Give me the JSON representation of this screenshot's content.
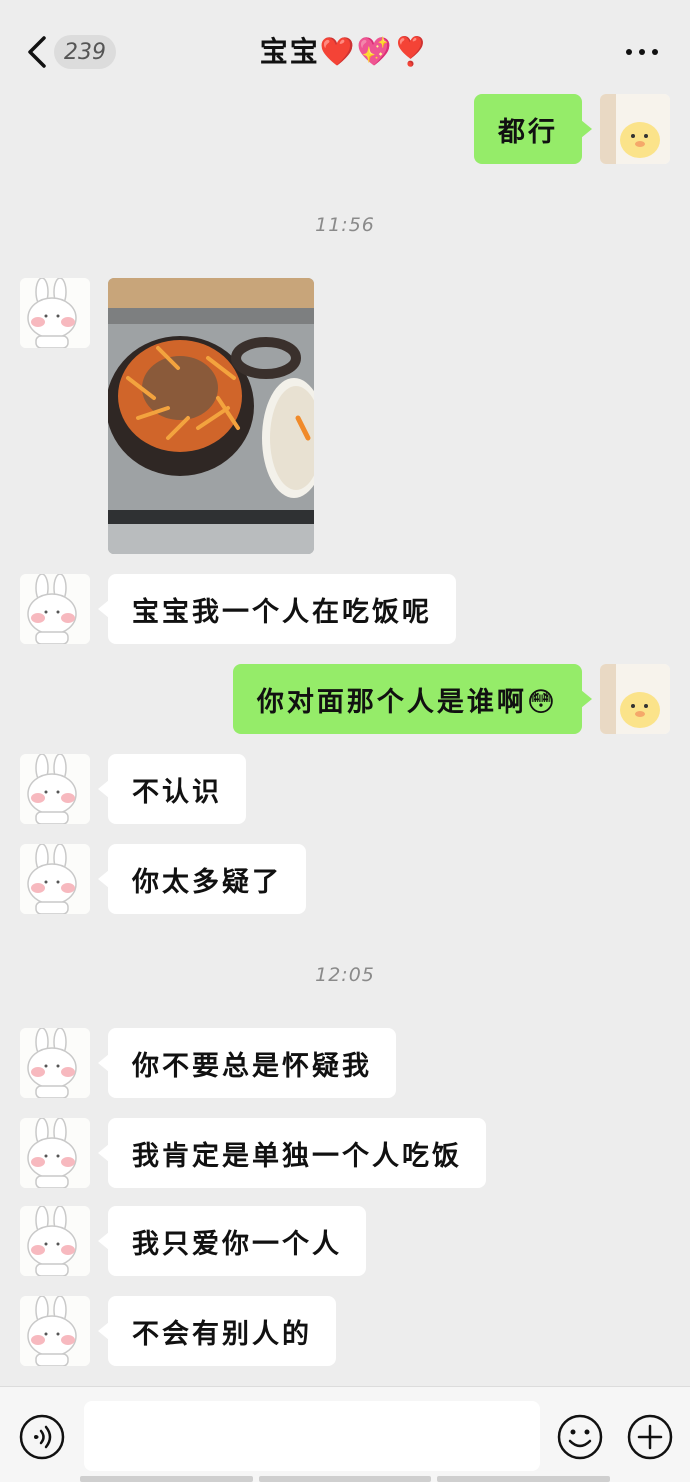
{
  "header": {
    "back_badge": "239",
    "title": "宝宝❤️💖❣️"
  },
  "messages": [
    {
      "type": "text",
      "side": "out",
      "text": "都行"
    },
    {
      "type": "time",
      "text": "11:56"
    },
    {
      "type": "image",
      "side": "in",
      "text": ""
    },
    {
      "type": "text",
      "side": "in",
      "text": "宝宝我一个人在吃饭呢"
    },
    {
      "type": "text",
      "side": "out",
      "text": "你对面那个人是谁啊😳"
    },
    {
      "type": "text",
      "side": "in",
      "text": "不认识"
    },
    {
      "type": "text",
      "side": "in",
      "text": "你太多疑了"
    },
    {
      "type": "time",
      "text": "12:05"
    },
    {
      "type": "text",
      "side": "in",
      "text": "你不要总是怀疑我"
    },
    {
      "type": "text",
      "side": "in",
      "text": "我肯定是单独一个人吃饭"
    },
    {
      "type": "text",
      "side": "in",
      "text": "我只爱你一个人"
    },
    {
      "type": "text",
      "side": "in",
      "text": "不会有别人的"
    }
  ],
  "input_bar": {
    "voice_icon": "voice-icon",
    "emoji_icon": "emoji-icon",
    "plus_icon": "plus-icon",
    "text_value": ""
  },
  "colors": {
    "background": "#ededed",
    "outgoing_bubble": "#95ec69",
    "incoming_bubble": "#ffffff"
  }
}
